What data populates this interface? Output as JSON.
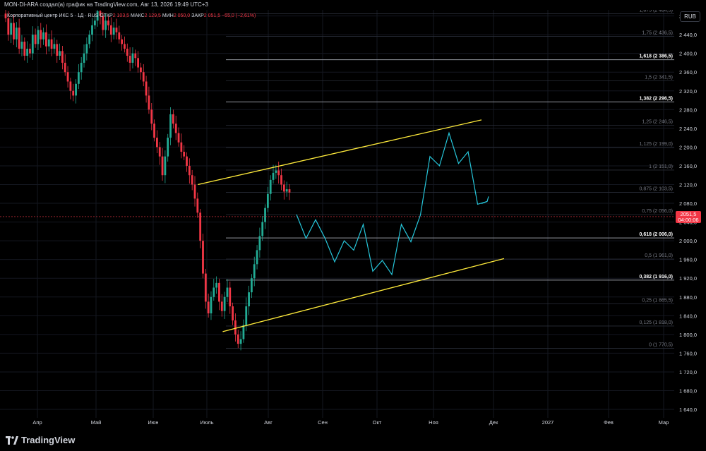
{
  "header": {
    "author_line": "MON-DI-ARA создал(а) график на TradingView.com, Авг 13, 2026 19:49 UTC+3",
    "symbol": "Корпоративный центр ИКС 5 · 1Д · RUS",
    "open_label": "ОТКР",
    "open": "2 103,5",
    "high_label": "МАКС",
    "high": "2 129,5",
    "low_label": "МИН",
    "low": "2 050,0",
    "close_label": "ЗАКР",
    "close": "2 051,5",
    "change": "−55,0 (−2,61%)",
    "currency": "RUB"
  },
  "footer": {
    "brand": "TradingView"
  },
  "colors": {
    "up": "#22ab94",
    "down": "#f23645",
    "channel": "#ffeb3b",
    "projection": "#26c6da",
    "grid": "#1e222d",
    "text": "#d1d4dc",
    "fib": "#363a45"
  },
  "chart_data": {
    "type": "candlestick",
    "title": "Корпоративный центр ИКС 5 · 1Д · RUS",
    "x_labels": [
      "Апр",
      "Май",
      "Июн",
      "Июль",
      "Авг",
      "Сен",
      "Окт",
      "Ноя",
      "Дек",
      "2027",
      "Фев",
      "Мар"
    ],
    "y_ticks": [
      "2 480,0",
      "2 440,0",
      "2 400,0",
      "2 360,0",
      "2 320,0",
      "2 280,0",
      "2 240,0",
      "2 200,0",
      "2 160,0",
      "2 120,0",
      "2 080,0",
      "2 040,0",
      "2 000,0",
      "1 960,0",
      "1 920,0",
      "1 880,0",
      "1 840,0",
      "1 800,0",
      "1 760,0",
      "1 720,0",
      "1 680,0",
      "1 640,0"
    ],
    "y_tick_values": [
      2480,
      2440,
      2400,
      2360,
      2320,
      2280,
      2240,
      2200,
      2160,
      2120,
      2080,
      2040,
      2000,
      1960,
      1920,
      1880,
      1840,
      1800,
      1760,
      1720,
      1680,
      1640
    ],
    "ylim": [
      1622,
      2514
    ],
    "last_price": {
      "value": "2051,5",
      "countdown": "04:00:06",
      "y": 2051.5
    },
    "fib_levels": [
      {
        "label": "1,875 (2 484,5)",
        "value": 2484.5,
        "bold": false
      },
      {
        "label": "1,75 (2 436,5)",
        "value": 2436.5,
        "bold": false
      },
      {
        "label": "1,618 (2 386,5)",
        "value": 2386.5,
        "bold": true
      },
      {
        "label": "1,5 (2 341,5)",
        "value": 2341.5,
        "bold": false
      },
      {
        "label": "1,382 (2 296,5)",
        "value": 2296.5,
        "bold": true
      },
      {
        "label": "1,25 (2 246,5)",
        "value": 2246.5,
        "bold": false
      },
      {
        "label": "1,125 (2 199,0)",
        "value": 2199.0,
        "bold": false
      },
      {
        "label": "1 (2 151,0)",
        "value": 2151.0,
        "bold": false
      },
      {
        "label": "0,875 (2 103,5)",
        "value": 2103.5,
        "bold": false
      },
      {
        "label": "0,75 (2 056,0)",
        "value": 2056.0,
        "bold": false
      },
      {
        "label": "0,618 (2 006,0)",
        "value": 2006.0,
        "bold": true
      },
      {
        "label": "0,5 (1 961,0)",
        "value": 1961.0,
        "bold": false
      },
      {
        "label": "0,382 (1 916,0)",
        "value": 1916.0,
        "bold": true
      },
      {
        "label": "0,25 (1 865,5)",
        "value": 1865.5,
        "bold": false
      },
      {
        "label": "0,125 (1 818,0)",
        "value": 1818.0,
        "bold": false
      },
      {
        "label": "0 (1 770,5)",
        "value": 1770.5,
        "bold": false
      }
    ],
    "candle_path": [
      2475,
      2440,
      2465,
      2430,
      2455,
      2410,
      2425,
      2395,
      2410,
      2400,
      2440,
      2420,
      2450,
      2430,
      2445,
      2415,
      2430,
      2410,
      2420,
      2395,
      2405,
      2380,
      2360,
      2340,
      2320,
      2310,
      2335,
      2360,
      2380,
      2400,
      2420,
      2440,
      2460,
      2470,
      2490,
      2480,
      2450,
      2470,
      2460,
      2440,
      2455,
      2445,
      2430,
      2420,
      2410,
      2395,
      2380,
      2400,
      2390,
      2370,
      2360,
      2340,
      2310,
      2280,
      2250,
      2220,
      2200,
      2180,
      2140,
      2180,
      2220,
      2270,
      2250,
      2230,
      2210,
      2190,
      2180,
      2160,
      2140,
      2120,
      2090,
      2060,
      2000,
      1930,
      1870,
      1845,
      1880,
      1900,
      1910,
      1870,
      1850,
      1880,
      1900,
      1860,
      1830,
      1800,
      1780,
      1790,
      1820,
      1860,
      1890,
      1920,
      1950,
      1980,
      2010,
      2040,
      2070,
      2100,
      2130,
      2145,
      2150,
      2140,
      2120,
      2105,
      2110,
      2103
    ],
    "channel_upper": {
      "x": [
        "2026-06-26",
        "2026-11-25"
      ],
      "y": [
        2120,
        2258
      ]
    },
    "channel_lower": {
      "x": [
        "2026-07-09",
        "2026-12-07"
      ],
      "y": [
        1806,
        1962
      ]
    },
    "projection": [
      2056,
      2005,
      2045,
      2005,
      1955,
      2000,
      1980,
      2035,
      1935,
      1958,
      1928,
      2035,
      1998,
      2055,
      2180,
      2160,
      2230,
      2165,
      2190,
      2078,
      2084
    ]
  }
}
